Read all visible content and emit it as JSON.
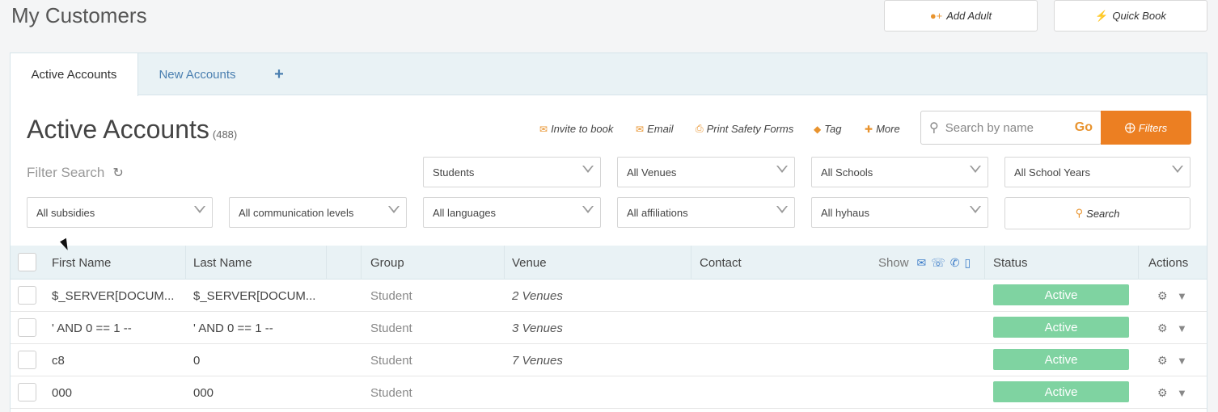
{
  "header": {
    "title": "My Customers",
    "add_adult": "Add Adult",
    "quick_book": "Quick Book"
  },
  "tabs": [
    {
      "label": "Active Accounts",
      "active": true
    },
    {
      "label": "New Accounts",
      "active": false
    },
    {
      "label": "+",
      "active": false
    }
  ],
  "section": {
    "title": "Active Accounts",
    "count": "(488)"
  },
  "actions": {
    "invite": "Invite to book",
    "email": "Email",
    "print": "Print Safety Forms",
    "tag": "Tag",
    "more": "More"
  },
  "search": {
    "placeholder": "Search by name",
    "go": "Go",
    "filters": "Filters"
  },
  "filter": {
    "label": "Filter Search",
    "row1": [
      "Students",
      "All Venues",
      "All Schools",
      "All School Years"
    ],
    "row2": [
      "All subsidies",
      "All communication levels",
      "All languages",
      "All affiliations",
      "All hyhaus"
    ],
    "search_button": "Search"
  },
  "table": {
    "columns": {
      "first_name": "First Name",
      "last_name": "Last Name",
      "group": "Group",
      "venue": "Venue",
      "contact": "Contact",
      "show": "Show",
      "status": "Status",
      "actions": "Actions"
    },
    "rows": [
      {
        "first": "$_SERVER[DOCUM...",
        "last": "$_SERVER[DOCUM...",
        "group": "Student",
        "venue": "2 Venues",
        "status": "Active"
      },
      {
        "first": "' AND 0 == 1 --",
        "last": "' AND 0 == 1 --",
        "group": "Student",
        "venue": "3 Venues",
        "status": "Active"
      },
      {
        "first": "c8",
        "last": "0",
        "group": "Student",
        "venue": "7 Venues",
        "status": "Active"
      },
      {
        "first": "000",
        "last": "000",
        "group": "Student",
        "venue": "",
        "status": "Active"
      }
    ]
  },
  "colors": {
    "accent": "#ec7f22",
    "link": "#4a7fb0",
    "active_badge": "#7fd3a1"
  }
}
